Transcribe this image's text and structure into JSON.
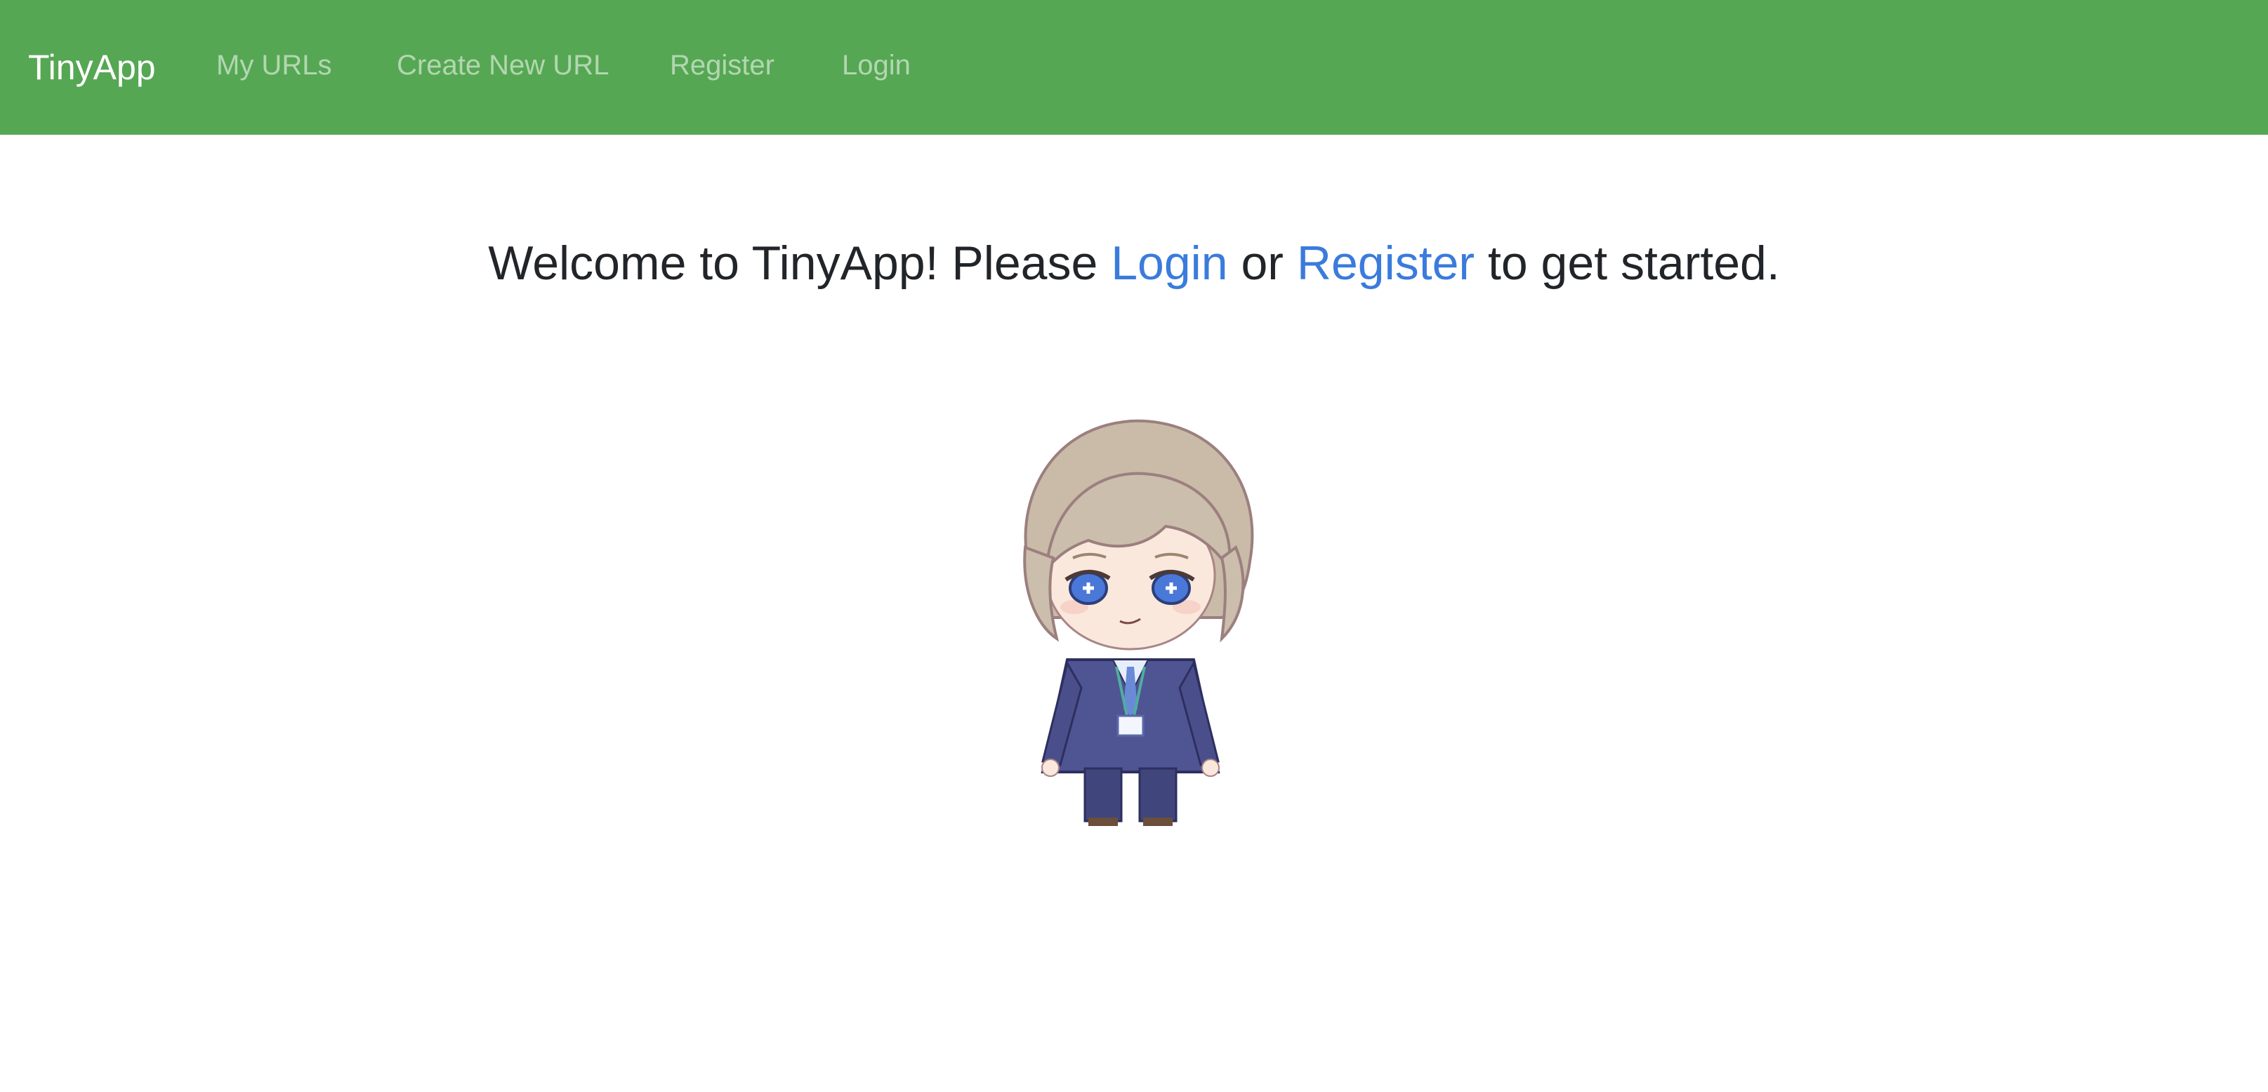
{
  "navbar": {
    "brand": "TinyApp",
    "links": [
      {
        "label": "My URLs"
      },
      {
        "label": "Create New URL"
      },
      {
        "label": "Register"
      },
      {
        "label": "Login"
      }
    ],
    "background_color": "#56a753"
  },
  "welcome": {
    "prefix": "Welcome to TinyApp! Please ",
    "login_link": "Login",
    "middle": " or ",
    "register_link": "Register",
    "suffix": " to get started.",
    "link_color": "#3a7bdc"
  },
  "mascot": {
    "icon": "chibi-character-illustration"
  }
}
